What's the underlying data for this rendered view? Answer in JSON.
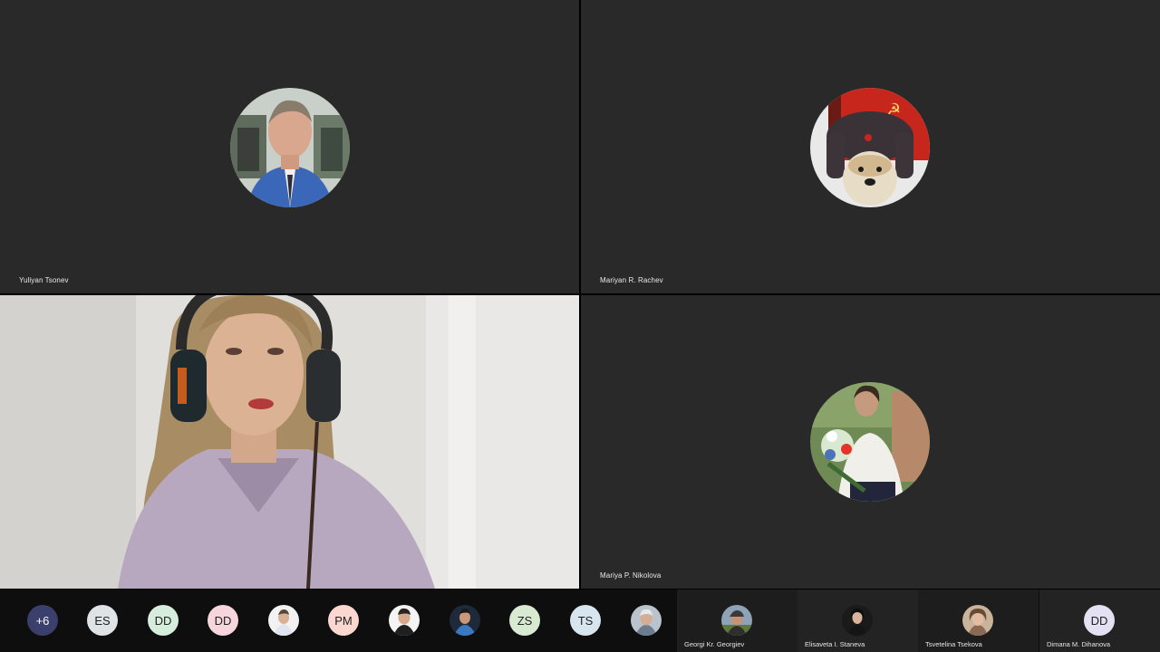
{
  "tiles": [
    {
      "name": "Yuliyan Tsonev",
      "avatar": "photo-man-blue-shirt"
    },
    {
      "name": "Mariyan R. Rachev",
      "avatar": "photo-dog-fur-hat"
    },
    {
      "name": "",
      "video": "live-camera-woman-headphones"
    },
    {
      "name": "Mariya P. Nikolova",
      "avatar": "photo-woman-flowers"
    }
  ],
  "strip": {
    "more": "+6",
    "items": [
      {
        "initials": "ES",
        "color": "#dfe3e6"
      },
      {
        "initials": "DD",
        "color": "#d6ecdc"
      },
      {
        "initials": "DD",
        "color": "#f6d6dc"
      },
      {
        "initials": "",
        "avatar": "photo-man-white-bg"
      },
      {
        "initials": "PM",
        "color": "#fbd8cf"
      },
      {
        "initials": "",
        "avatar": "photo-man-dark-hair"
      },
      {
        "initials": "",
        "avatar": "photo-man-blue-bg"
      },
      {
        "initials": "ZS",
        "color": "#d9ead3"
      },
      {
        "initials": "TS",
        "color": "#d7e6ee"
      },
      {
        "initials": "",
        "avatar": "photo-older-man"
      }
    ]
  },
  "panels": [
    {
      "name": "Georgi Kr. Georgiev",
      "avatar": "photo-man-cap"
    },
    {
      "name": "Elisaveta I. Staneva",
      "avatar": "photo-woman-dark"
    },
    {
      "name": "Tsvetelina Tsekova",
      "avatar": "photo-woman-curly"
    },
    {
      "name": "Dimana M. Dihanova",
      "initials": "DD",
      "color": "#e4e1f3"
    }
  ]
}
